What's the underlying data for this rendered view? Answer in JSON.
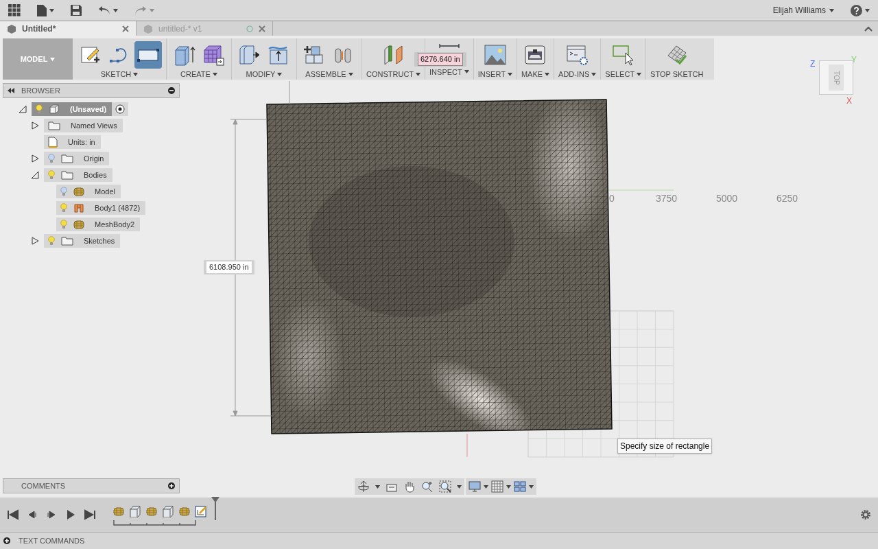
{
  "top_bar": {
    "user": "Elijah Williams"
  },
  "tabs": [
    {
      "label": "Untitled*",
      "selected": true,
      "saved": false
    },
    {
      "label": "untitled-* v1",
      "selected": false,
      "saved": true
    }
  ],
  "toolbar": {
    "workspace": "MODEL",
    "groups": [
      {
        "label": "SKETCH",
        "has_menu": true,
        "tools": [
          {
            "kind": "sketch",
            "selected": false
          },
          {
            "kind": "spline",
            "selected": false
          },
          {
            "kind": "rectangle",
            "selected": true
          }
        ]
      },
      {
        "label": "CREATE",
        "has_menu": true,
        "tools": [
          {
            "kind": "extrude",
            "selected": false
          },
          {
            "kind": "form",
            "selected": false
          }
        ]
      },
      {
        "label": "MODIFY",
        "has_menu": true,
        "tools": [
          {
            "kind": "presspull",
            "selected": false
          },
          {
            "kind": "surface",
            "selected": false
          }
        ]
      },
      {
        "label": "ASSEMBLE",
        "has_menu": true,
        "tools": [
          {
            "kind": "component",
            "selected": false
          },
          {
            "kind": "joint",
            "selected": false
          }
        ]
      },
      {
        "label": "CONSTRUCT",
        "has_menu": true,
        "tools": [
          {
            "kind": "plane",
            "selected": false
          }
        ]
      },
      {
        "label": "INSPECT",
        "has_menu": true,
        "tools": [
          {
            "kind": "measure",
            "selected": false
          }
        ]
      },
      {
        "label": "INSERT",
        "has_menu": true,
        "tools": [
          {
            "kind": "image",
            "selected": false
          }
        ]
      },
      {
        "label": "MAKE",
        "has_menu": true,
        "tools": [
          {
            "kind": "printer",
            "selected": false
          }
        ]
      },
      {
        "label": "ADD-INS",
        "has_menu": true,
        "tools": [
          {
            "kind": "script",
            "selected": false
          }
        ]
      },
      {
        "label": "SELECT",
        "has_menu": true,
        "tools": [
          {
            "kind": "select",
            "selected": false
          }
        ]
      },
      {
        "label": "STOP SKETCH",
        "has_menu": false,
        "tools": [
          {
            "kind": "stop",
            "selected": false
          }
        ]
      }
    ]
  },
  "browser": {
    "title": "BROWSER",
    "tree": [
      {
        "label": "(Unsaved)",
        "kind": "component",
        "expanded": true,
        "visible": true,
        "active": true,
        "children": [
          {
            "label": "Named Views",
            "kind": "folder",
            "expanded": false
          },
          {
            "label": "Units: in",
            "kind": "units"
          },
          {
            "label": "Origin",
            "kind": "folder",
            "expanded": false,
            "visible": false
          },
          {
            "label": "Bodies",
            "kind": "folder",
            "expanded": true,
            "visible": true,
            "children": [
              {
                "label": "Model",
                "kind": "mesh",
                "visible": false
              },
              {
                "label": "Body1 (4872)",
                "kind": "solid",
                "visible": true
              },
              {
                "label": "MeshBody2",
                "kind": "mesh",
                "visible": true
              }
            ]
          },
          {
            "label": "Sketches",
            "kind": "folder",
            "expanded": false,
            "visible": true
          }
        ]
      }
    ]
  },
  "canvas": {
    "width_dimension": "6276.640 in",
    "height_dimension": "6108.950 in",
    "axis_labels": [
      "0",
      "3750",
      "5000",
      "6250"
    ],
    "tooltip": "Specify size of rectangle",
    "view_cube": {
      "face": "TOP",
      "axes": [
        "Z",
        "Y",
        "X"
      ]
    }
  },
  "comments": {
    "title": "COMMENTS"
  },
  "timeline": [
    {
      "kind": "mesh"
    },
    {
      "kind": "solid"
    },
    {
      "kind": "mesh"
    },
    {
      "kind": "solid"
    },
    {
      "kind": "mesh"
    },
    {
      "kind": "sketch"
    }
  ],
  "text_commands": {
    "title": "TEXT COMMANDS"
  }
}
